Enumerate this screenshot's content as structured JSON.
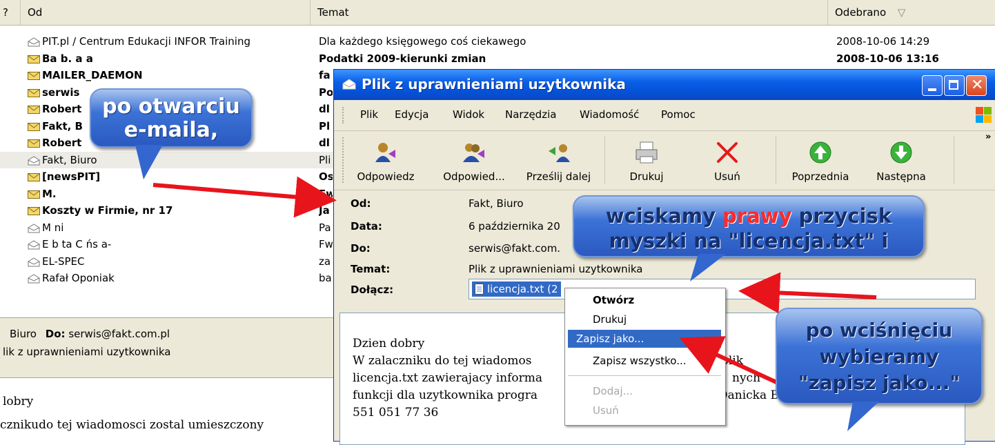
{
  "list": {
    "headers": {
      "from": "Od",
      "subject": "Temat",
      "received": "Odebrano"
    },
    "rows": [
      {
        "from": "PIT.pl / Centrum Edukacji INFOR Training",
        "subject": "Dla każdego księgowego coś ciekawego",
        "date": "2008-10-06 14:29",
        "read": true
      },
      {
        "from": "Ba b. a    a",
        "subject": "Podatki 2009-kierunki zmian",
        "date": "2008-10-06 13:16",
        "read": false
      },
      {
        "from": "MAILER_DAEMON",
        "subject": "fa",
        "date": "",
        "read": false
      },
      {
        "from": "serwis",
        "subject": "Po",
        "date": "",
        "read": false
      },
      {
        "from": "Robert",
        "subject": "dl",
        "date": "",
        "read": false
      },
      {
        "from": "Fakt, B",
        "subject": "Pl",
        "date": "",
        "read": false
      },
      {
        "from": "Robert",
        "subject": "dl",
        "date": "",
        "read": false
      },
      {
        "from": "Fakt, Biuro",
        "subject": "Pli",
        "date": "",
        "read": true,
        "selected": true
      },
      {
        "from": "[newsPIT]",
        "subject": "Os",
        "date": "",
        "read": false
      },
      {
        "from": "M.",
        "subject": "Fw",
        "date": "",
        "read": false
      },
      {
        "from": "Koszty w Firmie, nr 17",
        "subject": "Ja",
        "date": "",
        "read": false
      },
      {
        "from": "M ni",
        "subject": "Pa",
        "date": "",
        "read": true
      },
      {
        "from": "E b ta C  ńs a-  ",
        "subject": "Fw",
        "date": "",
        "read": true
      },
      {
        "from": "EL-SPEC",
        "subject": "za",
        "date": "",
        "read": true
      },
      {
        "from": "Rafał Oponiak",
        "subject": "ba",
        "date": "",
        "read": true
      }
    ]
  },
  "preview": {
    "from_value": "Biuro",
    "to_label": "Do:",
    "to_value": "serwis@fakt.com.pl",
    "subject": "lik z uprawnieniami uzytkownika",
    "body_line1": "lobry",
    "body_line2": "cznikudo tej wiadomosci zostal umieszczony"
  },
  "window": {
    "title": "Plik z uprawnieniami uzytkownika",
    "menu": [
      "Plik",
      "Edycja",
      "Widok",
      "Narzędzia",
      "Wiadomość",
      "Pomoc"
    ],
    "toolbar": [
      "Odpowiedz",
      "Odpowied...",
      "Prześlij dalej",
      "Drukuj",
      "Usuń",
      "Poprzednia",
      "Następna"
    ],
    "fields": {
      "from_label": "Od:",
      "from_value": "Fakt, Biuro",
      "date_label": "Data:",
      "date_value": "6 października 20",
      "to_label": "Do:",
      "to_value": "serwis@fakt.com.",
      "subject_label": "Temat:",
      "subject_value": "Plik z uprawnieniami uzytkownika",
      "attach_label": "Dołącz:",
      "attach_value": "licencja.txt (2"
    },
    "body": {
      "line1": "Dzien dobry",
      "line2": "W zalaczniku do tej wiadomos",
      "line2b": "plik",
      "line3": "licencja.txt zawierajacy informa",
      "line3b": "nych",
      "line4": "funkcji dla uzytkownika progra",
      "line4b": "Danicka  Bydgoszcz",
      "line5": "551 051 77 36"
    }
  },
  "context_menu": {
    "items": [
      {
        "label": "Otwórz",
        "bold": true
      },
      {
        "label": "Drukuj"
      },
      {
        "label": "Zapisz jako...",
        "selected": true
      },
      {
        "label": "Zapisz wszystko..."
      },
      {
        "label": "Dodaj...",
        "disabled": true
      },
      {
        "label": "Usuń",
        "disabled": true
      }
    ]
  },
  "callouts": {
    "c1_line1": "po otwarciu",
    "c1_line2": "e-maila,",
    "c2_part1": "wciskamy ",
    "c2_red": "prawy",
    "c2_part2": " przycisk",
    "c2_line2": "myszki na \"licencja.txt\" i",
    "c3_line1": "po wciśnięciu",
    "c3_line2": "wybieramy",
    "c3_line3": "\"zapisz jako...\""
  },
  "colors": {
    "title_blue": "#0a5fe6",
    "selection": "#316ac5",
    "arrow_red": "#e8141c",
    "callout_blue": "#3c72d6",
    "red_text": "#ff2a2a"
  }
}
